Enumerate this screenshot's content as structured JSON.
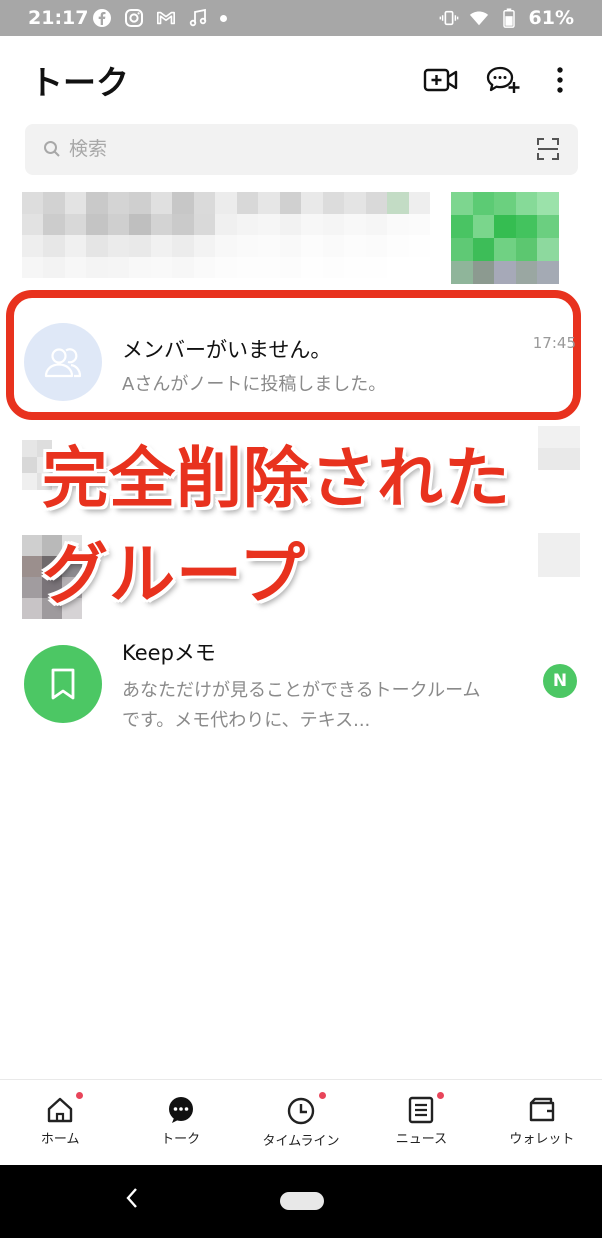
{
  "status_bar": {
    "time": "21:17",
    "battery": "61%",
    "icons_left": [
      "facebook-icon",
      "instagram-icon",
      "gmail-icon",
      "music-icon",
      "dot-icon"
    ],
    "icons_right": [
      "vibrate-icon",
      "wifi-icon",
      "battery-icon"
    ]
  },
  "header": {
    "title": "トーク",
    "actions": [
      "video-call-add-icon",
      "chat-add-icon",
      "more-icon"
    ]
  },
  "search": {
    "placeholder": "検索"
  },
  "chats": [
    {
      "name": "メンバーがいません。",
      "message": "Aさんがノートに投稿しました。",
      "time": "17:45",
      "avatar": "group-icon",
      "highlighted": true
    },
    {
      "name": "Keepメモ",
      "message": "あなただけが見ることができるトークルームです。メモ代わりに、テキス...",
      "avatar": "bookmark-icon",
      "badge": "N"
    }
  ],
  "annotation": {
    "line1": "完全削除された",
    "line2": "グループ",
    "color": "#e8321e"
  },
  "bottom_nav": [
    {
      "label": "ホーム",
      "icon": "home-icon",
      "dot": true
    },
    {
      "label": "トーク",
      "icon": "chat-icon",
      "dot": false,
      "active": true
    },
    {
      "label": "タイムライン",
      "icon": "clock-icon",
      "dot": true
    },
    {
      "label": "ニュース",
      "icon": "news-icon",
      "dot": true
    },
    {
      "label": "ウォレット",
      "icon": "wallet-icon",
      "dot": false
    }
  ],
  "colors": {
    "accent_red": "#e8321e",
    "line_green": "#4cc764",
    "group_avatar_bg": "#dfe8f7"
  }
}
